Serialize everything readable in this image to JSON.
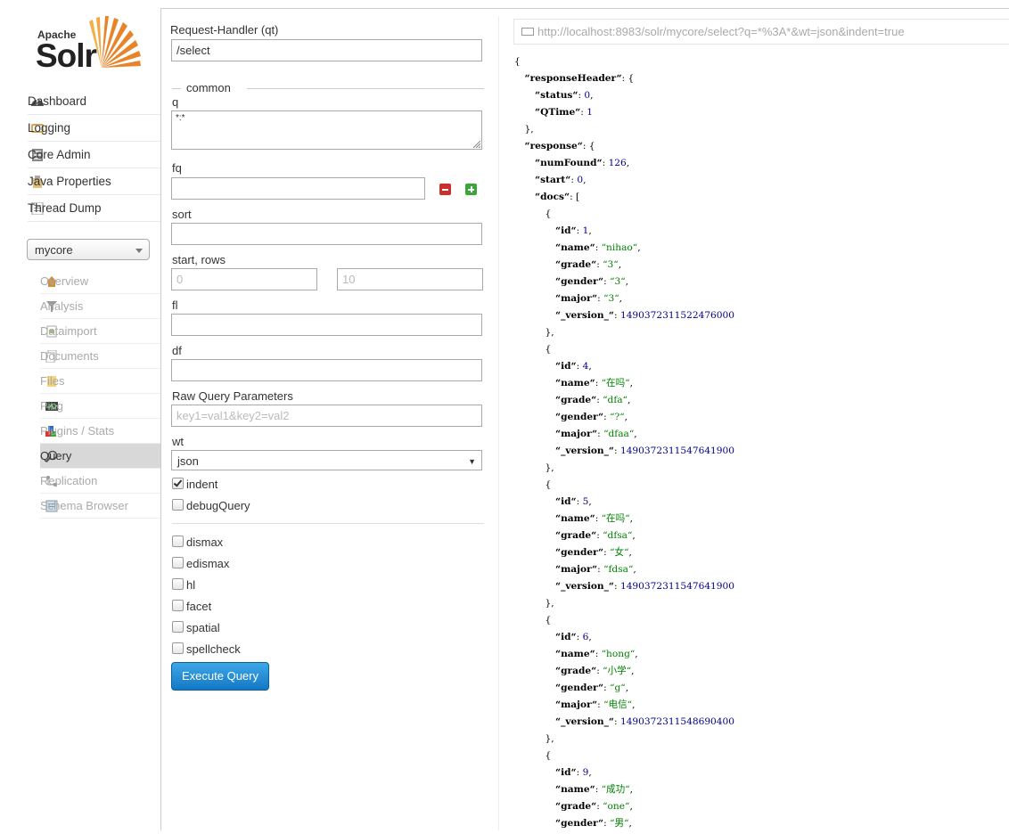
{
  "logo": {
    "top": "Apache",
    "main": "Solr"
  },
  "nav": [
    {
      "label": "Dashboard",
      "icon": "dashboard-icon"
    },
    {
      "label": "Logging",
      "icon": "logging-icon"
    },
    {
      "label": "Core Admin",
      "icon": "core-admin-icon"
    },
    {
      "label": "Java Properties",
      "icon": "java-properties-icon"
    },
    {
      "label": "Thread Dump",
      "icon": "thread-dump-icon"
    }
  ],
  "core_selector": {
    "value": "mycore"
  },
  "core_nav": [
    {
      "label": "Overview",
      "icon": "overview-icon"
    },
    {
      "label": "Analysis",
      "icon": "analysis-icon"
    },
    {
      "label": "Dataimport",
      "icon": "dataimport-icon"
    },
    {
      "label": "Documents",
      "icon": "documents-icon"
    },
    {
      "label": "Files",
      "icon": "files-icon"
    },
    {
      "label": "Ping",
      "icon": "ping-icon"
    },
    {
      "label": "Plugins / Stats",
      "icon": "plugins-icon"
    },
    {
      "label": "Query",
      "icon": "query-icon",
      "active": true
    },
    {
      "label": "Replication",
      "icon": "replication-icon"
    },
    {
      "label": "Schema Browser",
      "icon": "schema-browser-icon"
    }
  ],
  "form": {
    "qt_label": "Request-Handler (qt)",
    "qt_value": "/select",
    "common_legend": "common",
    "q_label": "q",
    "q_value": "*:*",
    "fq_label": "fq",
    "fq_value": "",
    "sort_label": "sort",
    "sort_value": "",
    "start_rows_label": "start, rows",
    "start_placeholder": "0",
    "rows_placeholder": "10",
    "fl_label": "fl",
    "df_label": "df",
    "raw_label": "Raw Query Parameters",
    "raw_placeholder": "key1=val1&key2=val2",
    "wt_label": "wt",
    "wt_value": "json",
    "indent_label": "indent",
    "debug_label": "debugQuery",
    "options": [
      {
        "label": "dismax",
        "checked": false
      },
      {
        "label": "edismax",
        "checked": false
      },
      {
        "label": "hl",
        "checked": false
      },
      {
        "label": "facet",
        "checked": false
      },
      {
        "label": "spatial",
        "checked": false
      },
      {
        "label": "spellcheck",
        "checked": false
      }
    ],
    "execute_label": "Execute Query"
  },
  "response": {
    "url": "http://localhost:8983/solr/mycore/select?q=*%3A*&wt=json&indent=true",
    "lines": [
      {
        "indent": 0,
        "p": "{"
      },
      {
        "indent": 1,
        "k": "responseHeader",
        "p": ": {"
      },
      {
        "indent": 2,
        "k": "status",
        "n": "0",
        "p2": ","
      },
      {
        "indent": 2,
        "k": "QTime",
        "n": "1"
      },
      {
        "indent": 1,
        "p": "},"
      },
      {
        "indent": 1,
        "k": "response",
        "p": ": {"
      },
      {
        "indent": 2,
        "k": "numFound",
        "n": "126",
        "p2": ","
      },
      {
        "indent": 2,
        "k": "start",
        "n": "0",
        "p2": ","
      },
      {
        "indent": 2,
        "k": "docs",
        "p": ": ["
      },
      {
        "indent": 3,
        "p": "{"
      },
      {
        "indent": 4,
        "k": "id",
        "n": "1",
        "p2": ","
      },
      {
        "indent": 4,
        "k": "name",
        "s": "nihao",
        "p2": ","
      },
      {
        "indent": 4,
        "k": "grade",
        "s": "3",
        "p2": ","
      },
      {
        "indent": 4,
        "k": "gender",
        "s": "3",
        "p2": ","
      },
      {
        "indent": 4,
        "k": "major",
        "s": "3",
        "p2": ","
      },
      {
        "indent": 4,
        "k": "_version_",
        "n": "1490372311522476000"
      },
      {
        "indent": 3,
        "p": "},"
      },
      {
        "indent": 3,
        "p": "{"
      },
      {
        "indent": 4,
        "k": "id",
        "n": "4",
        "p2": ","
      },
      {
        "indent": 4,
        "k": "name",
        "s": "在吗",
        "p2": ","
      },
      {
        "indent": 4,
        "k": "grade",
        "s": "dfa",
        "p2": ","
      },
      {
        "indent": 4,
        "k": "gender",
        "s": "?",
        "p2": ","
      },
      {
        "indent": 4,
        "k": "major",
        "s": "dfaa",
        "p2": ","
      },
      {
        "indent": 4,
        "k": "_version_",
        "n": "1490372311547641900"
      },
      {
        "indent": 3,
        "p": "},"
      },
      {
        "indent": 3,
        "p": "{"
      },
      {
        "indent": 4,
        "k": "id",
        "n": "5",
        "p2": ","
      },
      {
        "indent": 4,
        "k": "name",
        "s": "在吗",
        "p2": ","
      },
      {
        "indent": 4,
        "k": "grade",
        "s": "dfsa",
        "p2": ","
      },
      {
        "indent": 4,
        "k": "gender",
        "s": "女",
        "p2": ","
      },
      {
        "indent": 4,
        "k": "major",
        "s": "fdsa",
        "p2": ","
      },
      {
        "indent": 4,
        "k": "_version_",
        "n": "1490372311547641900"
      },
      {
        "indent": 3,
        "p": "},"
      },
      {
        "indent": 3,
        "p": "{"
      },
      {
        "indent": 4,
        "k": "id",
        "n": "6",
        "p2": ","
      },
      {
        "indent": 4,
        "k": "name",
        "s": "hong",
        "p2": ","
      },
      {
        "indent": 4,
        "k": "grade",
        "s": "小学",
        "p2": ","
      },
      {
        "indent": 4,
        "k": "gender",
        "s": "g",
        "p2": ","
      },
      {
        "indent": 4,
        "k": "major",
        "s": "电信",
        "p2": ","
      },
      {
        "indent": 4,
        "k": "_version_",
        "n": "1490372311548690400"
      },
      {
        "indent": 3,
        "p": "},"
      },
      {
        "indent": 3,
        "p": "{"
      },
      {
        "indent": 4,
        "k": "id",
        "n": "9",
        "p2": ","
      },
      {
        "indent": 4,
        "k": "name",
        "s": "成功",
        "p2": ","
      },
      {
        "indent": 4,
        "k": "grade",
        "s": "one",
        "p2": ","
      },
      {
        "indent": 4,
        "k": "gender",
        "s": "男",
        "p2": ","
      }
    ]
  },
  "colors": {
    "key": "#000000",
    "string": "#008000",
    "number": "#00008b",
    "button": "#1378c4"
  }
}
